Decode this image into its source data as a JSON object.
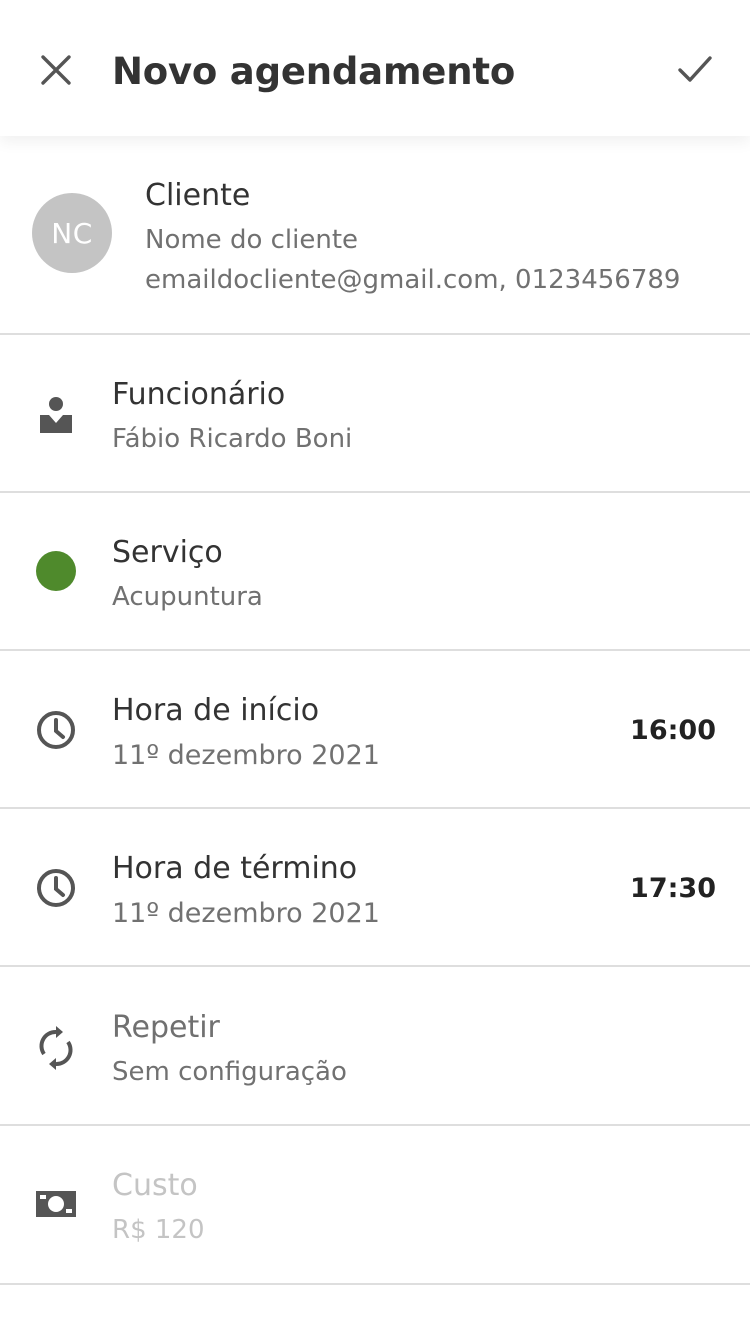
{
  "header": {
    "title": "Novo agendamento",
    "close_icon": "close-icon",
    "confirm_icon": "check-icon"
  },
  "client": {
    "section_label": "Cliente",
    "avatar_initials": "NC",
    "name": "Nome do cliente",
    "contact": "emaildocliente@gmail.com, 0123456789"
  },
  "employee": {
    "label": "Funcionário",
    "value": "Fábio Ricardo Boni",
    "icon": "person-icon"
  },
  "service": {
    "label": "Serviço",
    "value": "Acupuntura",
    "color": "#4f8a2c"
  },
  "start": {
    "label": "Hora de início",
    "date": "11º dezembro 2021",
    "time": "16:00",
    "icon": "clock-icon"
  },
  "end": {
    "label": "Hora de término",
    "date": "11º dezembro 2021",
    "time": "17:30",
    "icon": "clock-icon"
  },
  "repeat": {
    "label": "Repetir",
    "value": "Sem configuração",
    "icon": "repeat-icon"
  },
  "cost": {
    "label": "Custo",
    "value": "R$ 120",
    "icon": "money-icon"
  }
}
